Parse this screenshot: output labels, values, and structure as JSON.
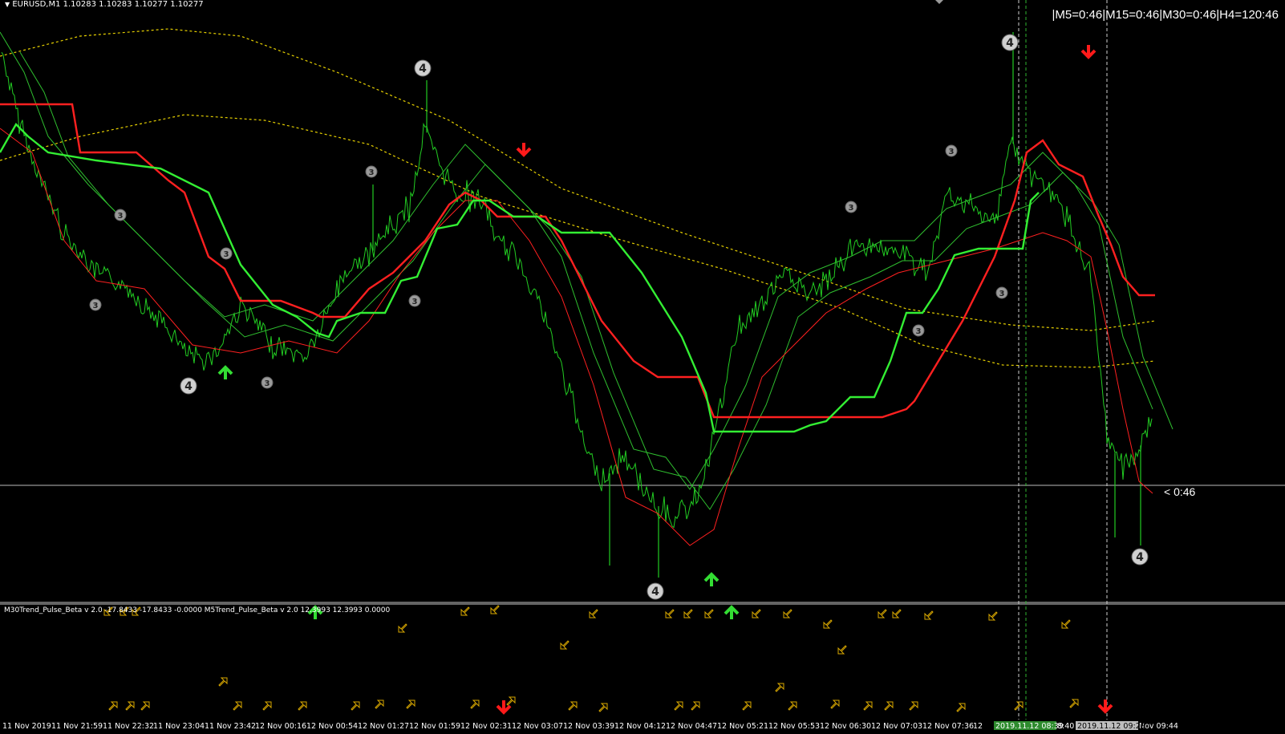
{
  "window": {
    "symbol_header": "EURUSD,M1  1.10283 1.10283 1.10277 1.10277",
    "timer_readout": "|M5=0:46|M15=0:46|M30=0:46|H4=120:46",
    "price_marker": "< 0:46"
  },
  "indicator": {
    "header": "M30Trend_Pulse_Beta v 2.0 -17.8433 -17.8433 -0.0000  M5Trend_Pulse_Beta v 2.0 12.3993 12.3993 0.0000"
  },
  "time_axis": {
    "labels": [
      "11 Nov 2019",
      "11 Nov 21:59",
      "11 Nov 22:32",
      "11 Nov 23:04",
      "11 Nov 23:42",
      "12 Nov 00:16",
      "12 Nov 00:54",
      "12 Nov 01:27",
      "12 Nov 01:59",
      "12 Nov 02:31",
      "12 Nov 03:07",
      "12 Nov 03:39",
      "12 Nov 04:12",
      "12 Nov 04:47",
      "12 Nov 05:21",
      "12 Nov 05:53",
      "12 Nov 06:30",
      "12 Nov 07:03",
      "12 Nov 07:36",
      "12",
      "8:40",
      "Nov 09:44"
    ],
    "highlight_green": "2019.11.12 08:39",
    "highlight_gray": "2019.11.12 09:29"
  },
  "colors": {
    "background": "#000000",
    "price": "#22cc22",
    "red_band": "#ff2020",
    "green_band": "#33ee33",
    "ma_dotted": "#e6d000",
    "up_arrow": "#33dd33",
    "down_arrow": "#ff1a1a",
    "wave_badge": "#9a9a9a",
    "small_arrow": "#d9a800"
  },
  "markers": {
    "badges": [
      {
        "label": "4",
        "big": true
      },
      {
        "label": "4",
        "big": true
      },
      {
        "label": "4",
        "big": true
      },
      {
        "label": "4",
        "big": true
      },
      {
        "label": "4",
        "big": true
      },
      {
        "label": "3",
        "big": false
      },
      {
        "label": "3",
        "big": false
      },
      {
        "label": "3",
        "big": false
      },
      {
        "label": "3",
        "big": false
      },
      {
        "label": "3",
        "big": false
      },
      {
        "label": "3",
        "big": false
      },
      {
        "label": "3",
        "big": false
      },
      {
        "label": "3",
        "big": false
      },
      {
        "label": "3",
        "big": false
      },
      {
        "label": "3",
        "big": false
      },
      {
        "label": "3",
        "big": false
      }
    ]
  }
}
